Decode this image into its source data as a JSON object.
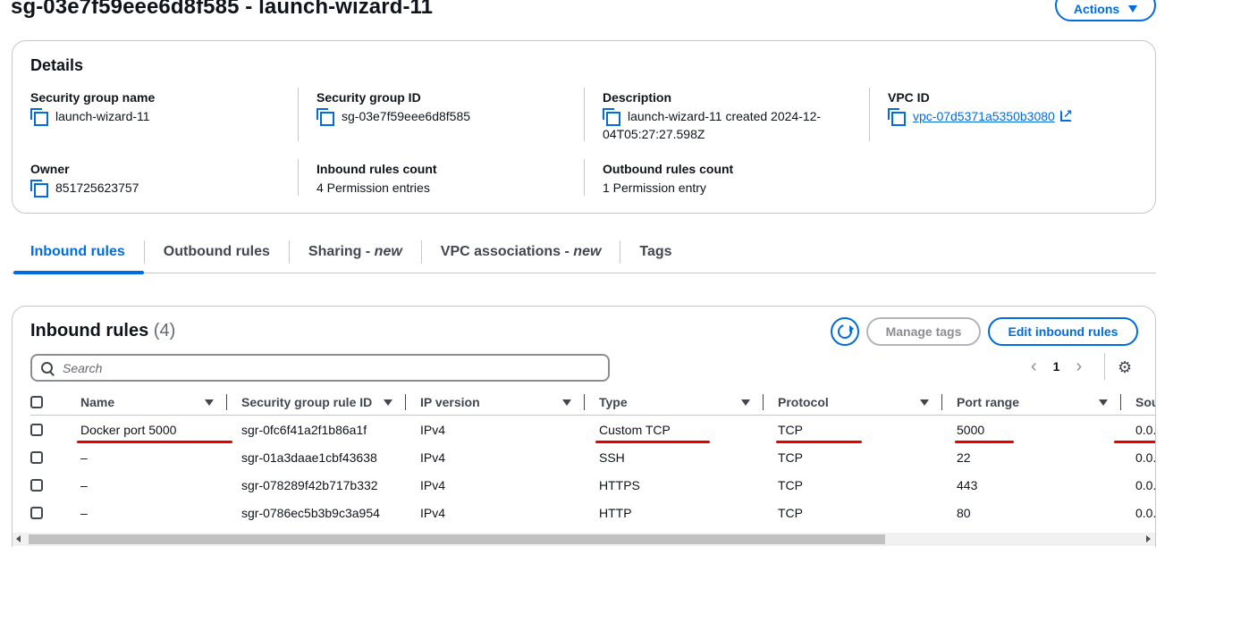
{
  "page": {
    "title": "sg-03e7f59eee6d8f585 - launch-wizard-11",
    "actions_label": "Actions"
  },
  "details": {
    "title": "Details",
    "security_group_name": {
      "label": "Security group name",
      "value": "launch-wizard-11"
    },
    "security_group_id": {
      "label": "Security group ID",
      "value": "sg-03e7f59eee6d8f585"
    },
    "description": {
      "label": "Description",
      "value_line1": "launch-wizard-11 created 2024-12-",
      "value_line2": "04T05:27:27.598Z"
    },
    "vpc_id": {
      "label": "VPC ID",
      "value": "vpc-07d5371a5350b3080"
    },
    "owner": {
      "label": "Owner",
      "value": "851725623757"
    },
    "inbound_rules_count": {
      "label": "Inbound rules count",
      "value": "4 Permission entries"
    },
    "outbound_rules_count": {
      "label": "Outbound rules count",
      "value": "1 Permission entry"
    }
  },
  "tabs": [
    {
      "label": "Inbound rules",
      "suffix": "",
      "active": true
    },
    {
      "label": "Outbound rules",
      "suffix": "",
      "active": false
    },
    {
      "label": "Sharing - ",
      "suffix": "new",
      "active": false
    },
    {
      "label": "VPC associations - ",
      "suffix": "new",
      "active": false
    },
    {
      "label": "Tags",
      "suffix": "",
      "active": false
    }
  ],
  "inbound": {
    "title": "Inbound rules",
    "count": "(4)",
    "manage_tags_label": "Manage tags",
    "edit_label": "Edit inbound rules",
    "search_placeholder": "Search",
    "page_number": "1",
    "columns": [
      "Name",
      "Security group rule ID",
      "IP version",
      "Type",
      "Protocol",
      "Port range",
      "Sou"
    ],
    "rows": [
      [
        "Docker port 5000",
        "sgr-0fc6f41a2f1b86a1f",
        "IPv4",
        "Custom TCP",
        "TCP",
        "5000",
        "0.0."
      ],
      [
        "–",
        "sgr-01a3daae1cbf43638",
        "IPv4",
        "SSH",
        "TCP",
        "22",
        "0.0."
      ],
      [
        "–",
        "sgr-078289f42b717b332",
        "IPv4",
        "HTTPS",
        "TCP",
        "443",
        "0.0."
      ],
      [
        "–",
        "sgr-0786ec5b3b9c3a954",
        "IPv4",
        "HTTP",
        "TCP",
        "80",
        "0.0."
      ]
    ]
  },
  "icons": {
    "copy": "copy-icon",
    "external": "external-link-icon",
    "refresh": "refresh-icon",
    "search": "search-icon",
    "settings": "gear-icon"
  },
  "colors": {
    "accent": "#006ce0",
    "annotation": "#e60000",
    "border": "#c6c6cd",
    "text": "#0f141a"
  }
}
